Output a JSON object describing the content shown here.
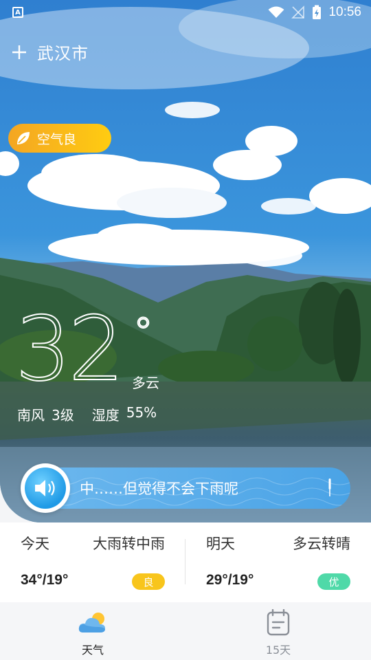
{
  "status_bar": {
    "app_icon_letter": "A",
    "time": "10:56"
  },
  "header": {
    "add_icon": "plus-icon",
    "city": "武汉市"
  },
  "air_quality": {
    "label": "空气良",
    "icon": "leaf-icon",
    "color_from": "#f4a623",
    "color_to": "#ffcc11"
  },
  "current": {
    "temperature": "32",
    "degree_symbol": "°",
    "condition": "多云",
    "wind_direction": "南风",
    "wind_level": "3级",
    "humidity_label": "湿度",
    "humidity_value": "55%"
  },
  "voice_banner": {
    "text": "中……但觉得不会下雨呢",
    "speaker_icon": "speaker-icon",
    "mic_icon": "microphone-icon",
    "color": "#5aaeea"
  },
  "forecast": {
    "today": {
      "day": "今天",
      "condition": "大雨转中雨",
      "range": "34°/19°",
      "aqi": "良",
      "aqi_color": "#f8c51c"
    },
    "tomorrow": {
      "day": "明天",
      "condition": "多云转晴",
      "range": "29°/19°",
      "aqi": "优",
      "aqi_color": "#4fd9a8"
    }
  },
  "bottom_nav": {
    "items": [
      {
        "label": "天气",
        "icon": "weather-cloud-sun-icon",
        "active": true
      },
      {
        "label": "15天",
        "icon": "calendar-icon",
        "active": false
      }
    ]
  }
}
